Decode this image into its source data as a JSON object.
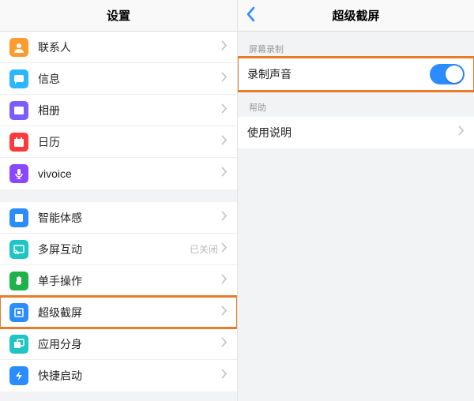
{
  "leftPane": {
    "title": "设置",
    "groups": [
      {
        "items": [
          {
            "key": "contacts",
            "label": "联系人",
            "iconBg": "#ff9a2e",
            "icon": "person"
          },
          {
            "key": "messages",
            "label": "信息",
            "iconBg": "#2bb6ff",
            "icon": "chat"
          },
          {
            "key": "photos",
            "label": "相册",
            "iconBg": "#7a5cff",
            "icon": "photo"
          },
          {
            "key": "calendar",
            "label": "日历",
            "iconBg": "#ff3a3a",
            "icon": "calendar"
          },
          {
            "key": "vivoice",
            "label": "vivoice",
            "iconBg": "#8a47ff",
            "icon": "mic"
          }
        ]
      },
      {
        "items": [
          {
            "key": "smart",
            "label": "智能体感",
            "iconBg": "#2b8cff",
            "icon": "square"
          },
          {
            "key": "multiscr",
            "label": "多屏互动",
            "iconBg": "#1fc4c4",
            "icon": "cast",
            "hint": "已关闭"
          },
          {
            "key": "onehand",
            "label": "单手操作",
            "iconBg": "#1fb24a",
            "icon": "hand"
          },
          {
            "key": "sscreen",
            "label": "超级截屏",
            "iconBg": "#2b8cff",
            "icon": "screenshot",
            "highlight": true
          },
          {
            "key": "clone",
            "label": "应用分身",
            "iconBg": "#1fc4c4",
            "icon": "clone"
          },
          {
            "key": "quick",
            "label": "快捷启动",
            "iconBg": "#2b8cff",
            "icon": "bolt"
          }
        ]
      }
    ]
  },
  "rightPane": {
    "title": "超级截屏",
    "sections": [
      {
        "header": "屏幕录制",
        "rows": [
          {
            "key": "recaudio",
            "label": "录制声音",
            "type": "toggle",
            "on": true,
            "highlight": true
          }
        ]
      },
      {
        "header": "帮助",
        "rows": [
          {
            "key": "manual",
            "label": "使用说明",
            "type": "disclosure"
          }
        ]
      }
    ]
  }
}
